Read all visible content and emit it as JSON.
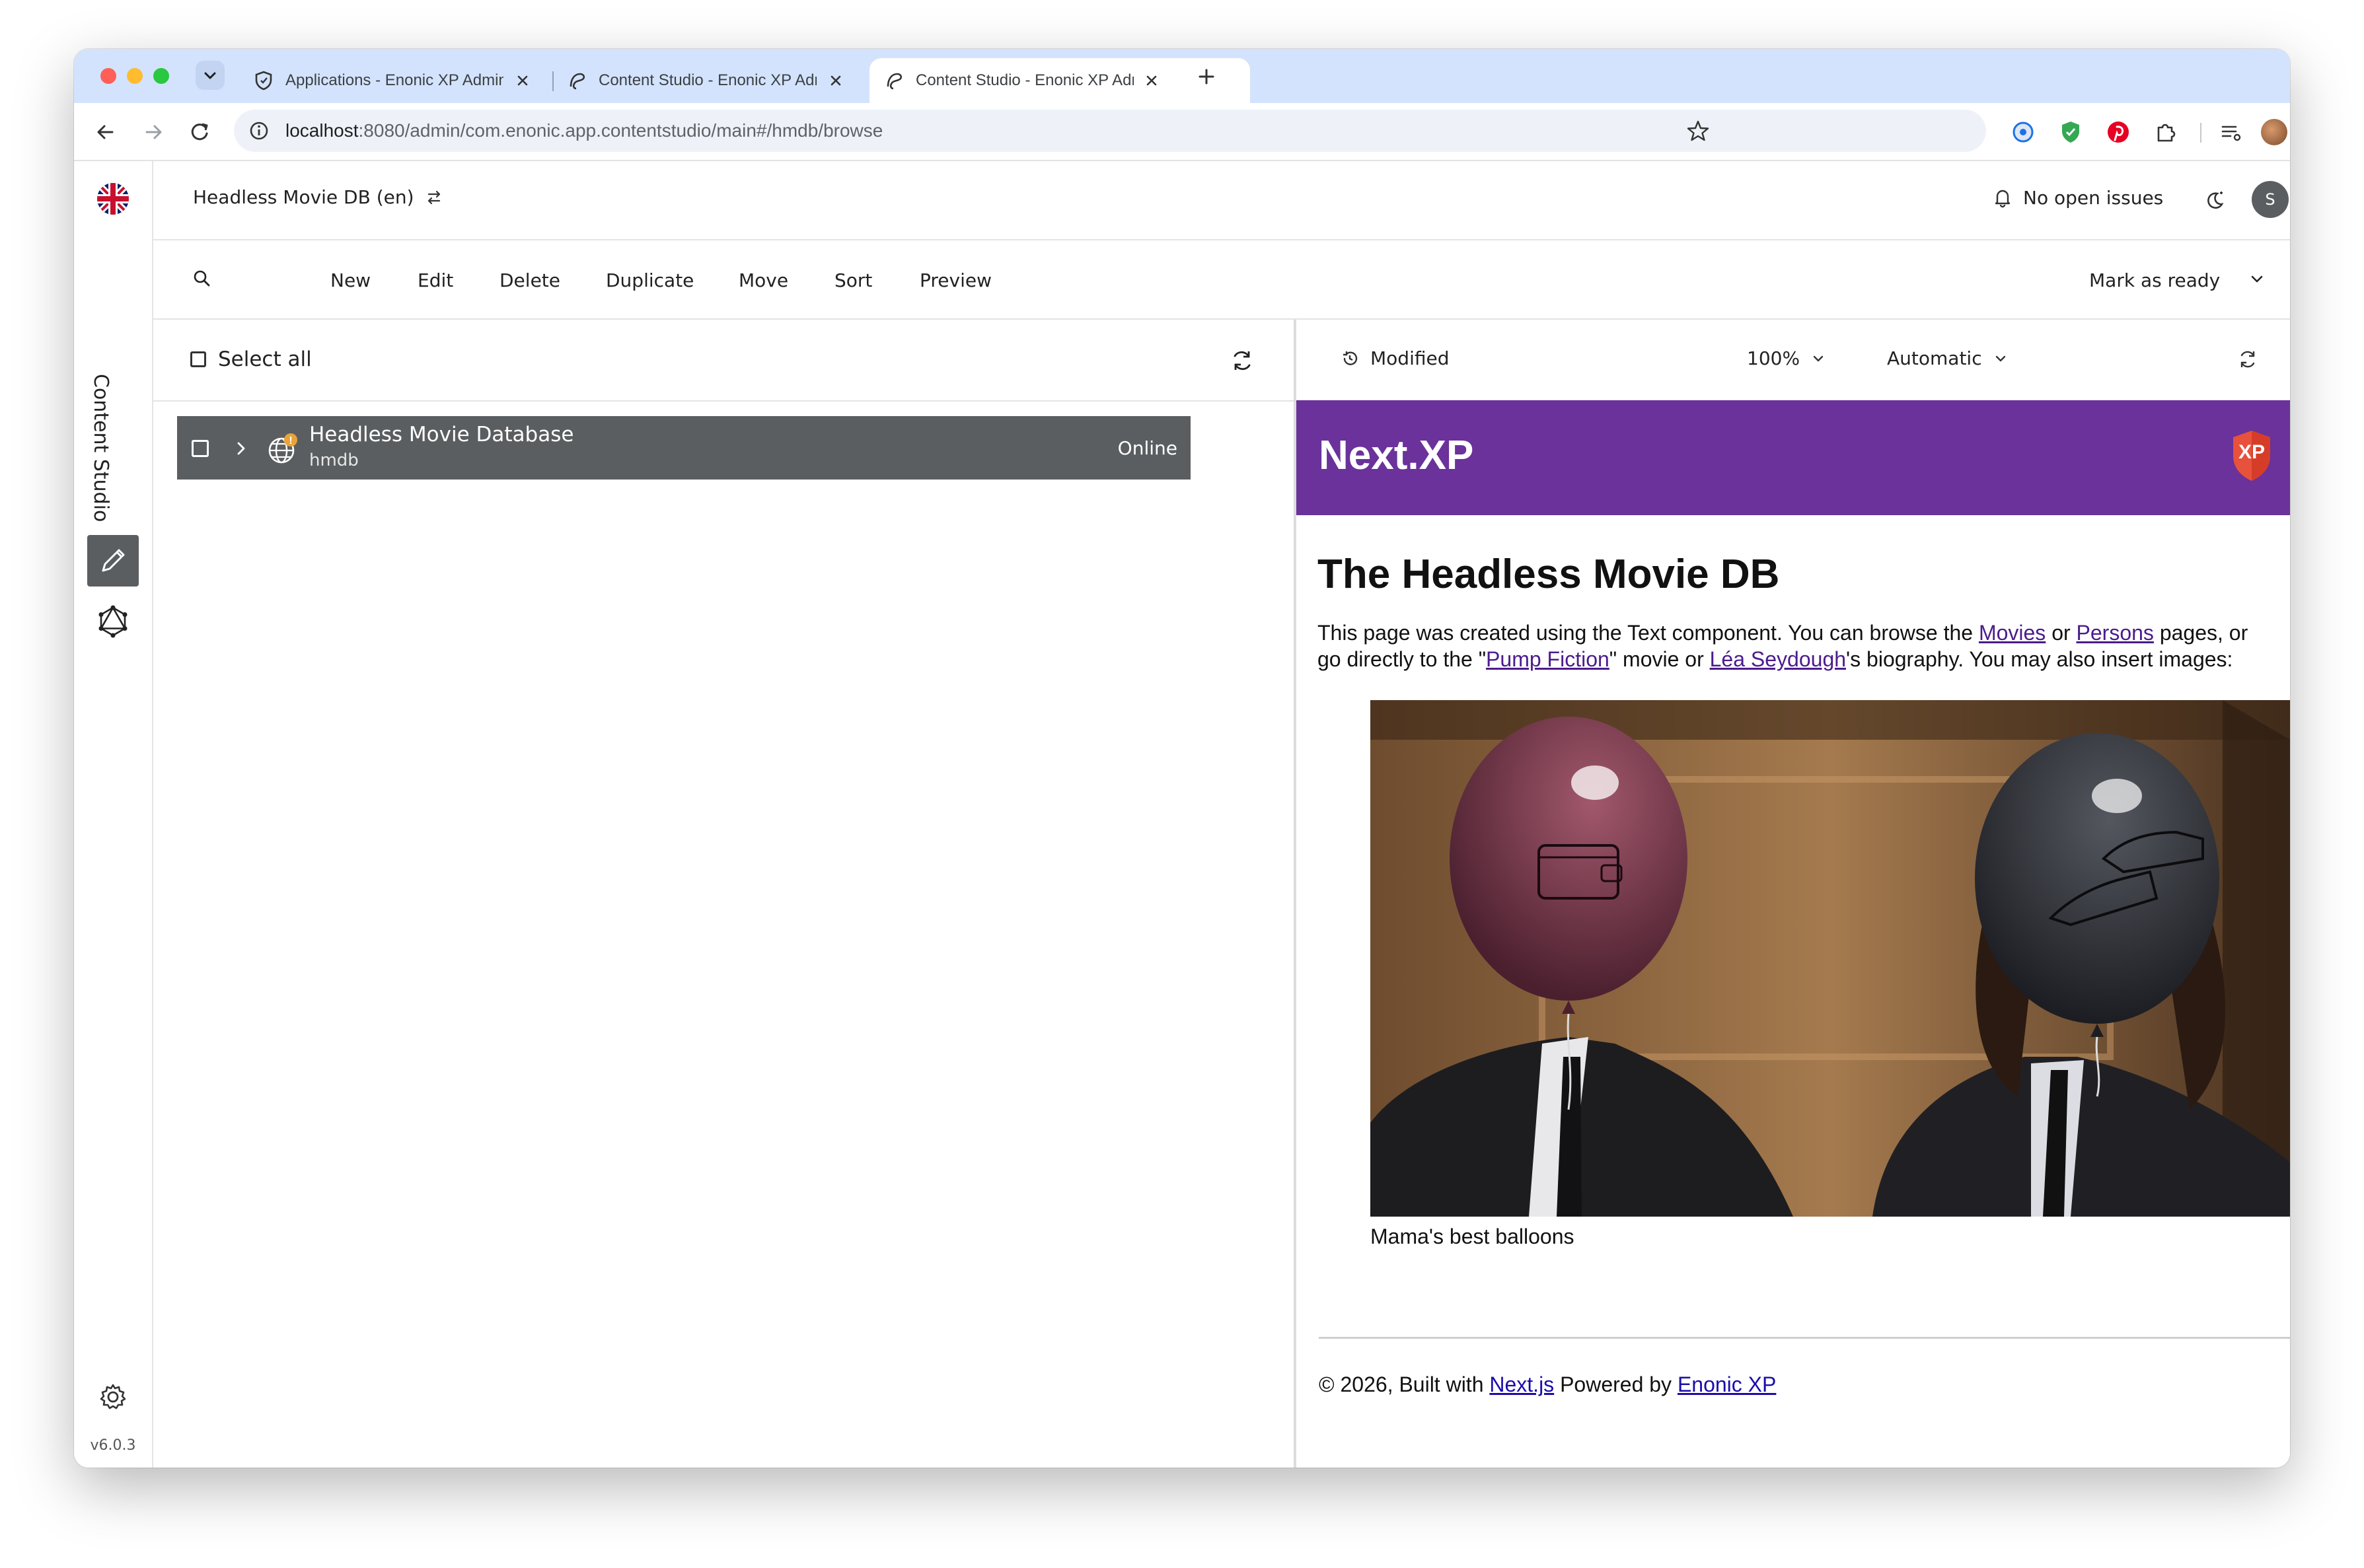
{
  "browser": {
    "tabs": [
      {
        "title": "Applications - Enonic XP Admin"
      },
      {
        "title": "Content Studio - Enonic XP Admin"
      },
      {
        "title": "Content Studio - Enonic XP Admin"
      }
    ],
    "url_host": "localhost",
    "url_path": ":8080/admin/com.enonic.app.contentstudio/main#/hmdb/browse"
  },
  "sidebar": {
    "app_name": "Content Studio",
    "version": "v6.0.3"
  },
  "header": {
    "project": "Headless Movie DB (en)",
    "issues": "No open issues",
    "user_initial": "S",
    "xp_badge": "XP"
  },
  "actions": {
    "new": "New",
    "edit": "Edit",
    "delete": "Delete",
    "duplicate": "Duplicate",
    "move": "Move",
    "sort": "Sort",
    "preview": "Preview",
    "mark_ready": "Mark as ready"
  },
  "tree": {
    "select_all": "Select all",
    "items": [
      {
        "name": "Headless Movie Database",
        "path": "hmdb",
        "status": "Online"
      }
    ]
  },
  "preview_toolbar": {
    "status": "Modified",
    "zoom": "100%",
    "mode": "Automatic"
  },
  "page": {
    "brand": "Next.XP",
    "logo_text": "XP",
    "heading": "The Headless Movie DB",
    "p_part1": "This page was created using the Text component. You can browse the ",
    "link_movies": "Movies",
    "p_part2": " or ",
    "link_persons": "Persons",
    "p_part3": " pages, or go directly to the \"",
    "link_pump": "Pump Fiction",
    "p_part4": "\" movie or ",
    "link_lea": "Léa Seydough",
    "p_part5": "'s biography. You may also insert images:",
    "caption": "Mama's best balloons",
    "footer_part1": "© 2026, Built with ",
    "footer_link1": "Next.js",
    "footer_part2": " Powered by ",
    "footer_link2": "Enonic XP"
  },
  "colors": {
    "brand_purple": "#6a329a",
    "selected_row": "#5b5e60",
    "tab_strip": "#d3e3fd",
    "warning_badge": "#e8a33a",
    "logo_red": "#e8513b"
  }
}
